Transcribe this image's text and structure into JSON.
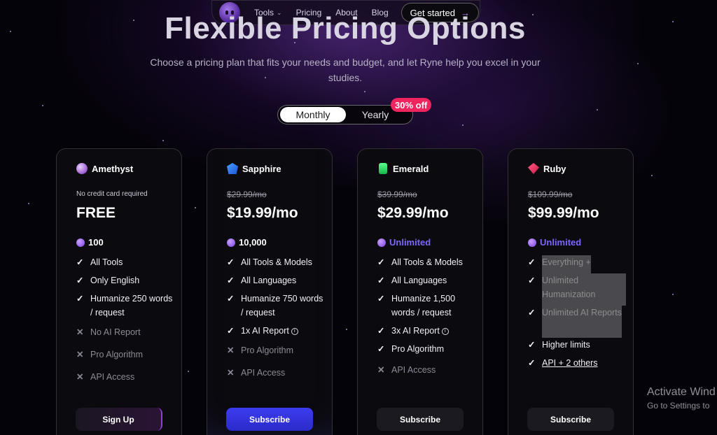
{
  "nav": {
    "links": [
      "Tools",
      "Pricing",
      "About",
      "Blog"
    ],
    "cta": "Get started"
  },
  "hero": {
    "title": "Flexible Pricing Options",
    "subtitle": "Choose a pricing plan that fits your needs and budget, and let Ryne help you excel in your studies."
  },
  "billing_toggle": {
    "monthly": "Monthly",
    "yearly": "Yearly",
    "discount": "30% off",
    "selected": "Monthly"
  },
  "plans": [
    {
      "name": "Amethyst",
      "note": "No credit card required",
      "price": "FREE",
      "credits": "100",
      "features": [
        {
          "text": "All Tools",
          "included": true
        },
        {
          "text": "Only English",
          "included": true
        },
        {
          "text": "Humanize 250 words / request",
          "included": true
        },
        {
          "text": "No AI Report",
          "included": false
        },
        {
          "text": "Pro Algorithm",
          "included": false
        },
        {
          "text": "API Access",
          "included": false
        }
      ],
      "button": "Sign Up"
    },
    {
      "name": "Sapphire",
      "old_price": "$29.99/mo",
      "price": "$19.99/mo",
      "credits": "10,000",
      "features": [
        {
          "text": "All Tools & Models",
          "included": true
        },
        {
          "text": "All Languages",
          "included": true
        },
        {
          "text": "Humanize 750 words / request",
          "included": true
        },
        {
          "text": "1x AI Report",
          "included": true
        },
        {
          "text": "Pro Algorithm",
          "included": false
        },
        {
          "text": "API Access",
          "included": false
        }
      ],
      "button": "Subscribe"
    },
    {
      "name": "Emerald",
      "old_price": "$39.99/mo",
      "price": "$29.99/mo",
      "credits": "Unlimited",
      "features": [
        {
          "text": "All Tools & Models",
          "included": true
        },
        {
          "text": "All Languages",
          "included": true
        },
        {
          "text": "Humanize 1,500 words / request",
          "included": true
        },
        {
          "text": "3x AI Report",
          "included": true
        },
        {
          "text": "Pro Algorithm",
          "included": true
        },
        {
          "text": "API Access",
          "included": false
        }
      ],
      "button": "Subscribe"
    },
    {
      "name": "Ruby",
      "old_price": "$109.99/mo",
      "price": "$99.99/mo",
      "credits": "Unlimited",
      "features": [
        {
          "text": "Everything +",
          "included": true
        },
        {
          "text": "Unlimited Humanization",
          "included": true
        },
        {
          "text": "Unlimited AI Reports",
          "included": true
        },
        {
          "text": "Higher limits",
          "included": true
        },
        {
          "text": "API + 2 others",
          "included": true
        }
      ],
      "button": "Subscribe"
    }
  ],
  "watermark": {
    "line1": "Activate Wind",
    "line2": "Go to Settings to"
  },
  "colors": {
    "accent_purple": "#7b3fe0",
    "subscribe_blue": "#3c3cf0",
    "discount_pink": "#f0245e",
    "unlimited_text": "#7b67ff"
  }
}
